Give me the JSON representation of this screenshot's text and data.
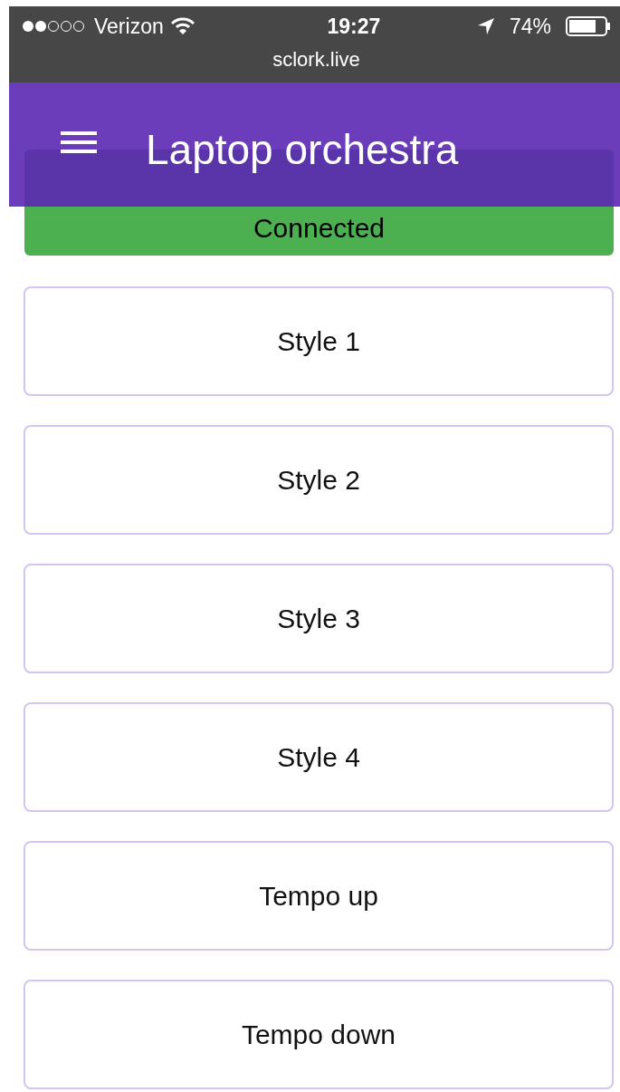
{
  "status_bar": {
    "carrier": "Verizon",
    "time": "19:27",
    "battery": "74%",
    "url": "sclork.live"
  },
  "header": {
    "title": "Laptop orchestra"
  },
  "connection": {
    "label": "Connected",
    "connected": true
  },
  "buttons": [
    {
      "label": "Style 1"
    },
    {
      "label": "Style 2"
    },
    {
      "label": "Style 3"
    },
    {
      "label": "Style 4"
    },
    {
      "label": "Tempo up"
    },
    {
      "label": "Tempo down"
    }
  ]
}
